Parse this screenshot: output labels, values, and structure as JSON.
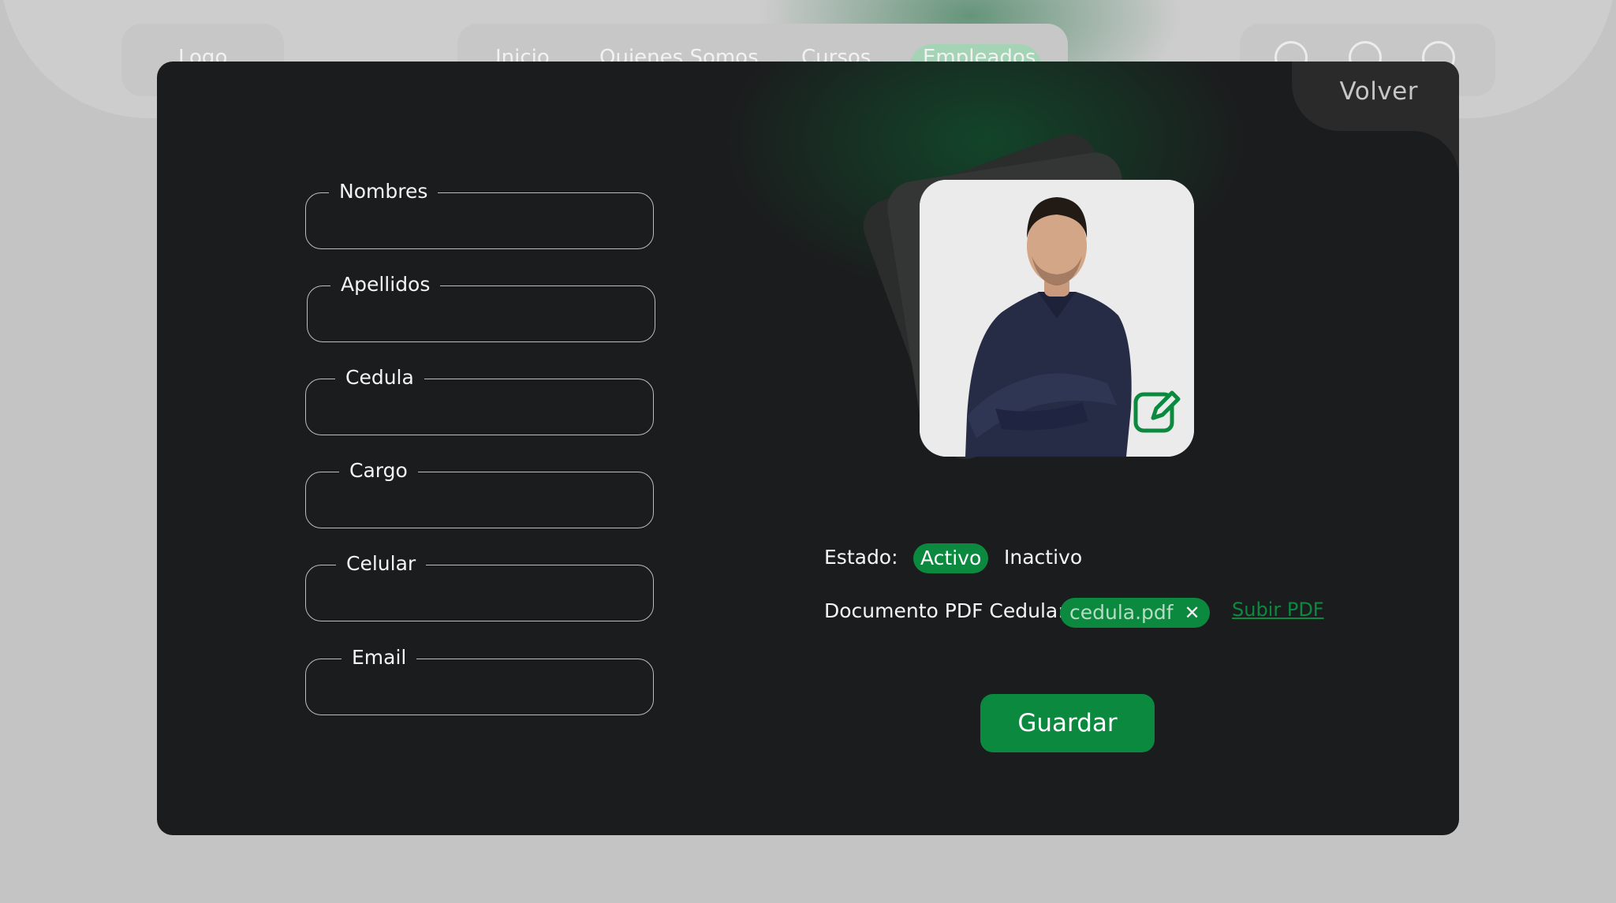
{
  "nav": {
    "logo": "Logo",
    "links": [
      "Inicio",
      "Quienes Somos",
      "Cursos",
      "Empleados"
    ],
    "active": "Empleados",
    "icons": [
      "settings-icon",
      "notification-icon",
      "user-icon"
    ]
  },
  "modal": {
    "back_label": "Volver",
    "fields": [
      {
        "label": "Nombres",
        "value": ""
      },
      {
        "label": "Apellidos",
        "value": ""
      },
      {
        "label": "Cedula",
        "value": ""
      },
      {
        "label": "Cargo",
        "value": ""
      },
      {
        "label": "Celular",
        "value": ""
      },
      {
        "label": "Email",
        "value": ""
      }
    ],
    "estado_label": "Estado:",
    "estado_options": [
      "Activo",
      "Inactivo"
    ],
    "estado_selected": "Activo",
    "pdf_label": "Documento PDF Cedula:",
    "pdf_file": "cedula.pdf",
    "upload_label": "Subir PDF",
    "save_label": "Guardar"
  },
  "colors": {
    "accent": "#0b8a3f",
    "modal_bg": "#1b1c1d",
    "page_bg": "#c4c4c4"
  }
}
